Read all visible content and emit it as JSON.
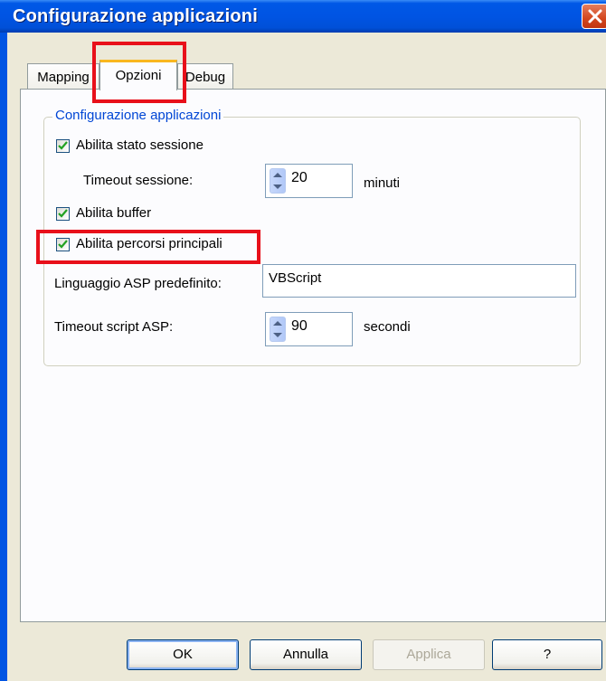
{
  "window": {
    "title": "Configurazione applicazioni"
  },
  "tabs": [
    {
      "label": "Mapping"
    },
    {
      "label": "Opzioni"
    },
    {
      "label": "Debug"
    }
  ],
  "group": {
    "title": "Configurazione applicazioni",
    "session_state": {
      "label": "Abilita stato sessione",
      "checked": true
    },
    "session_timeout": {
      "label": "Timeout sessione:",
      "value": "20",
      "unit": "minuti"
    },
    "buffer": {
      "label": "Abilita buffer",
      "checked": true
    },
    "parent_paths": {
      "label": "Abilita percorsi principali",
      "checked": true
    },
    "default_language": {
      "label": "Linguaggio ASP predefinito:",
      "value": "VBScript"
    },
    "script_timeout": {
      "label": "Timeout script ASP:",
      "value": "90",
      "unit": "secondi"
    }
  },
  "buttons": {
    "ok": "OK",
    "cancel": "Annulla",
    "apply": "Applica",
    "help": "?"
  },
  "colors": {
    "highlight": "#e8101a",
    "title_bar": "#0054e3",
    "group_title": "#0046d5"
  }
}
